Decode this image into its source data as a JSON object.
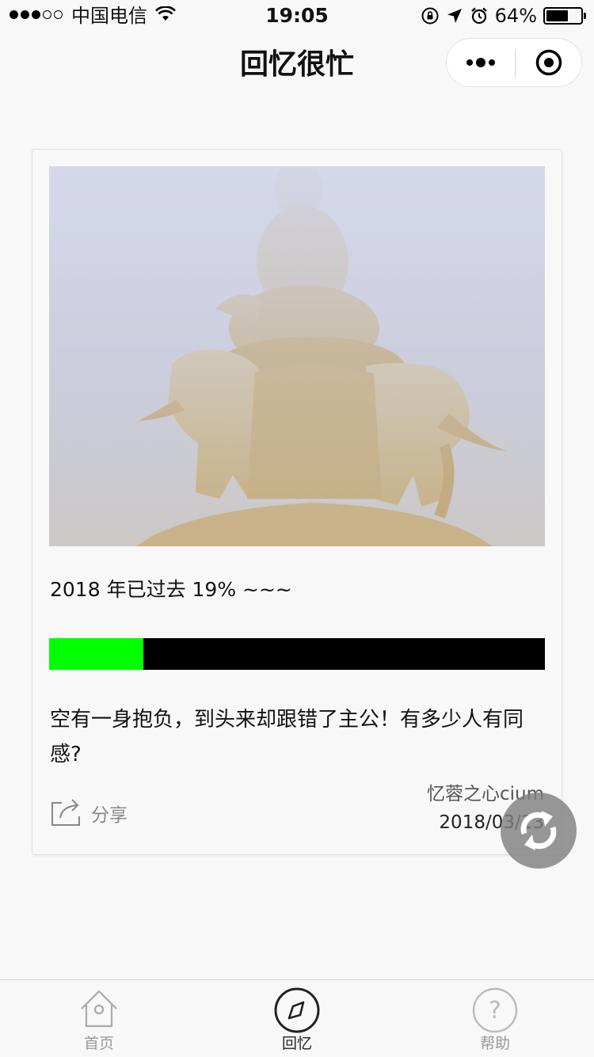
{
  "status_bar": {
    "carrier": "中国电信",
    "time": "19:05",
    "battery_percent": "64%",
    "battery_level": 0.64,
    "signal_bars": 3,
    "signal_total": 5
  },
  "nav": {
    "title": "回忆很忙"
  },
  "card": {
    "progress_text": "2018 年已过去 19% ~~~",
    "progress_fraction": 0.19,
    "progress_fill_color": "#00ff00",
    "progress_track_color": "#000000",
    "quote": "空有一身抱负，到头来却跟错了主公！有多少人有同感?",
    "share_label": "分享",
    "author": "忆蓉之心cium",
    "date": "2018/03/13"
  },
  "tabbar": {
    "items": [
      {
        "label": "首页",
        "icon": "home-icon",
        "active": false
      },
      {
        "label": "回忆",
        "icon": "compass-icon",
        "active": true
      },
      {
        "label": "帮助",
        "icon": "help-icon",
        "active": false
      }
    ]
  },
  "icons": {
    "wifi": "wifi-icon",
    "lock_rotation": "rotation-lock-icon",
    "location": "location-arrow-icon",
    "alarm": "alarm-icon",
    "more": "more-icon",
    "close": "close-target-icon",
    "share": "share-icon",
    "refresh": "refresh-icon"
  }
}
